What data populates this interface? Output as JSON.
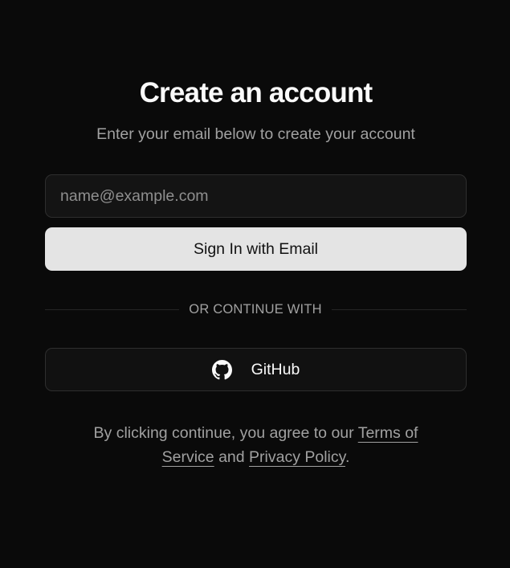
{
  "header": {
    "title": "Create an account",
    "subtitle": "Enter your email below to create your account"
  },
  "form": {
    "email_placeholder": "name@example.com",
    "email_value": "",
    "submit_label": "Sign In with Email"
  },
  "divider": {
    "label": "OR CONTINUE WITH"
  },
  "oauth": {
    "github_label": "GitHub",
    "github_icon": "github-icon"
  },
  "legal": {
    "prefix": "By clicking continue, you agree to our ",
    "terms_link": "Terms of Service",
    "middle": " and ",
    "privacy_link": "Privacy Policy",
    "suffix": "."
  },
  "colors": {
    "background": "#0a0a0a",
    "primary_button": "#e4e4e4",
    "muted_text": "#a1a1a1",
    "border": "#2e2e2e"
  }
}
